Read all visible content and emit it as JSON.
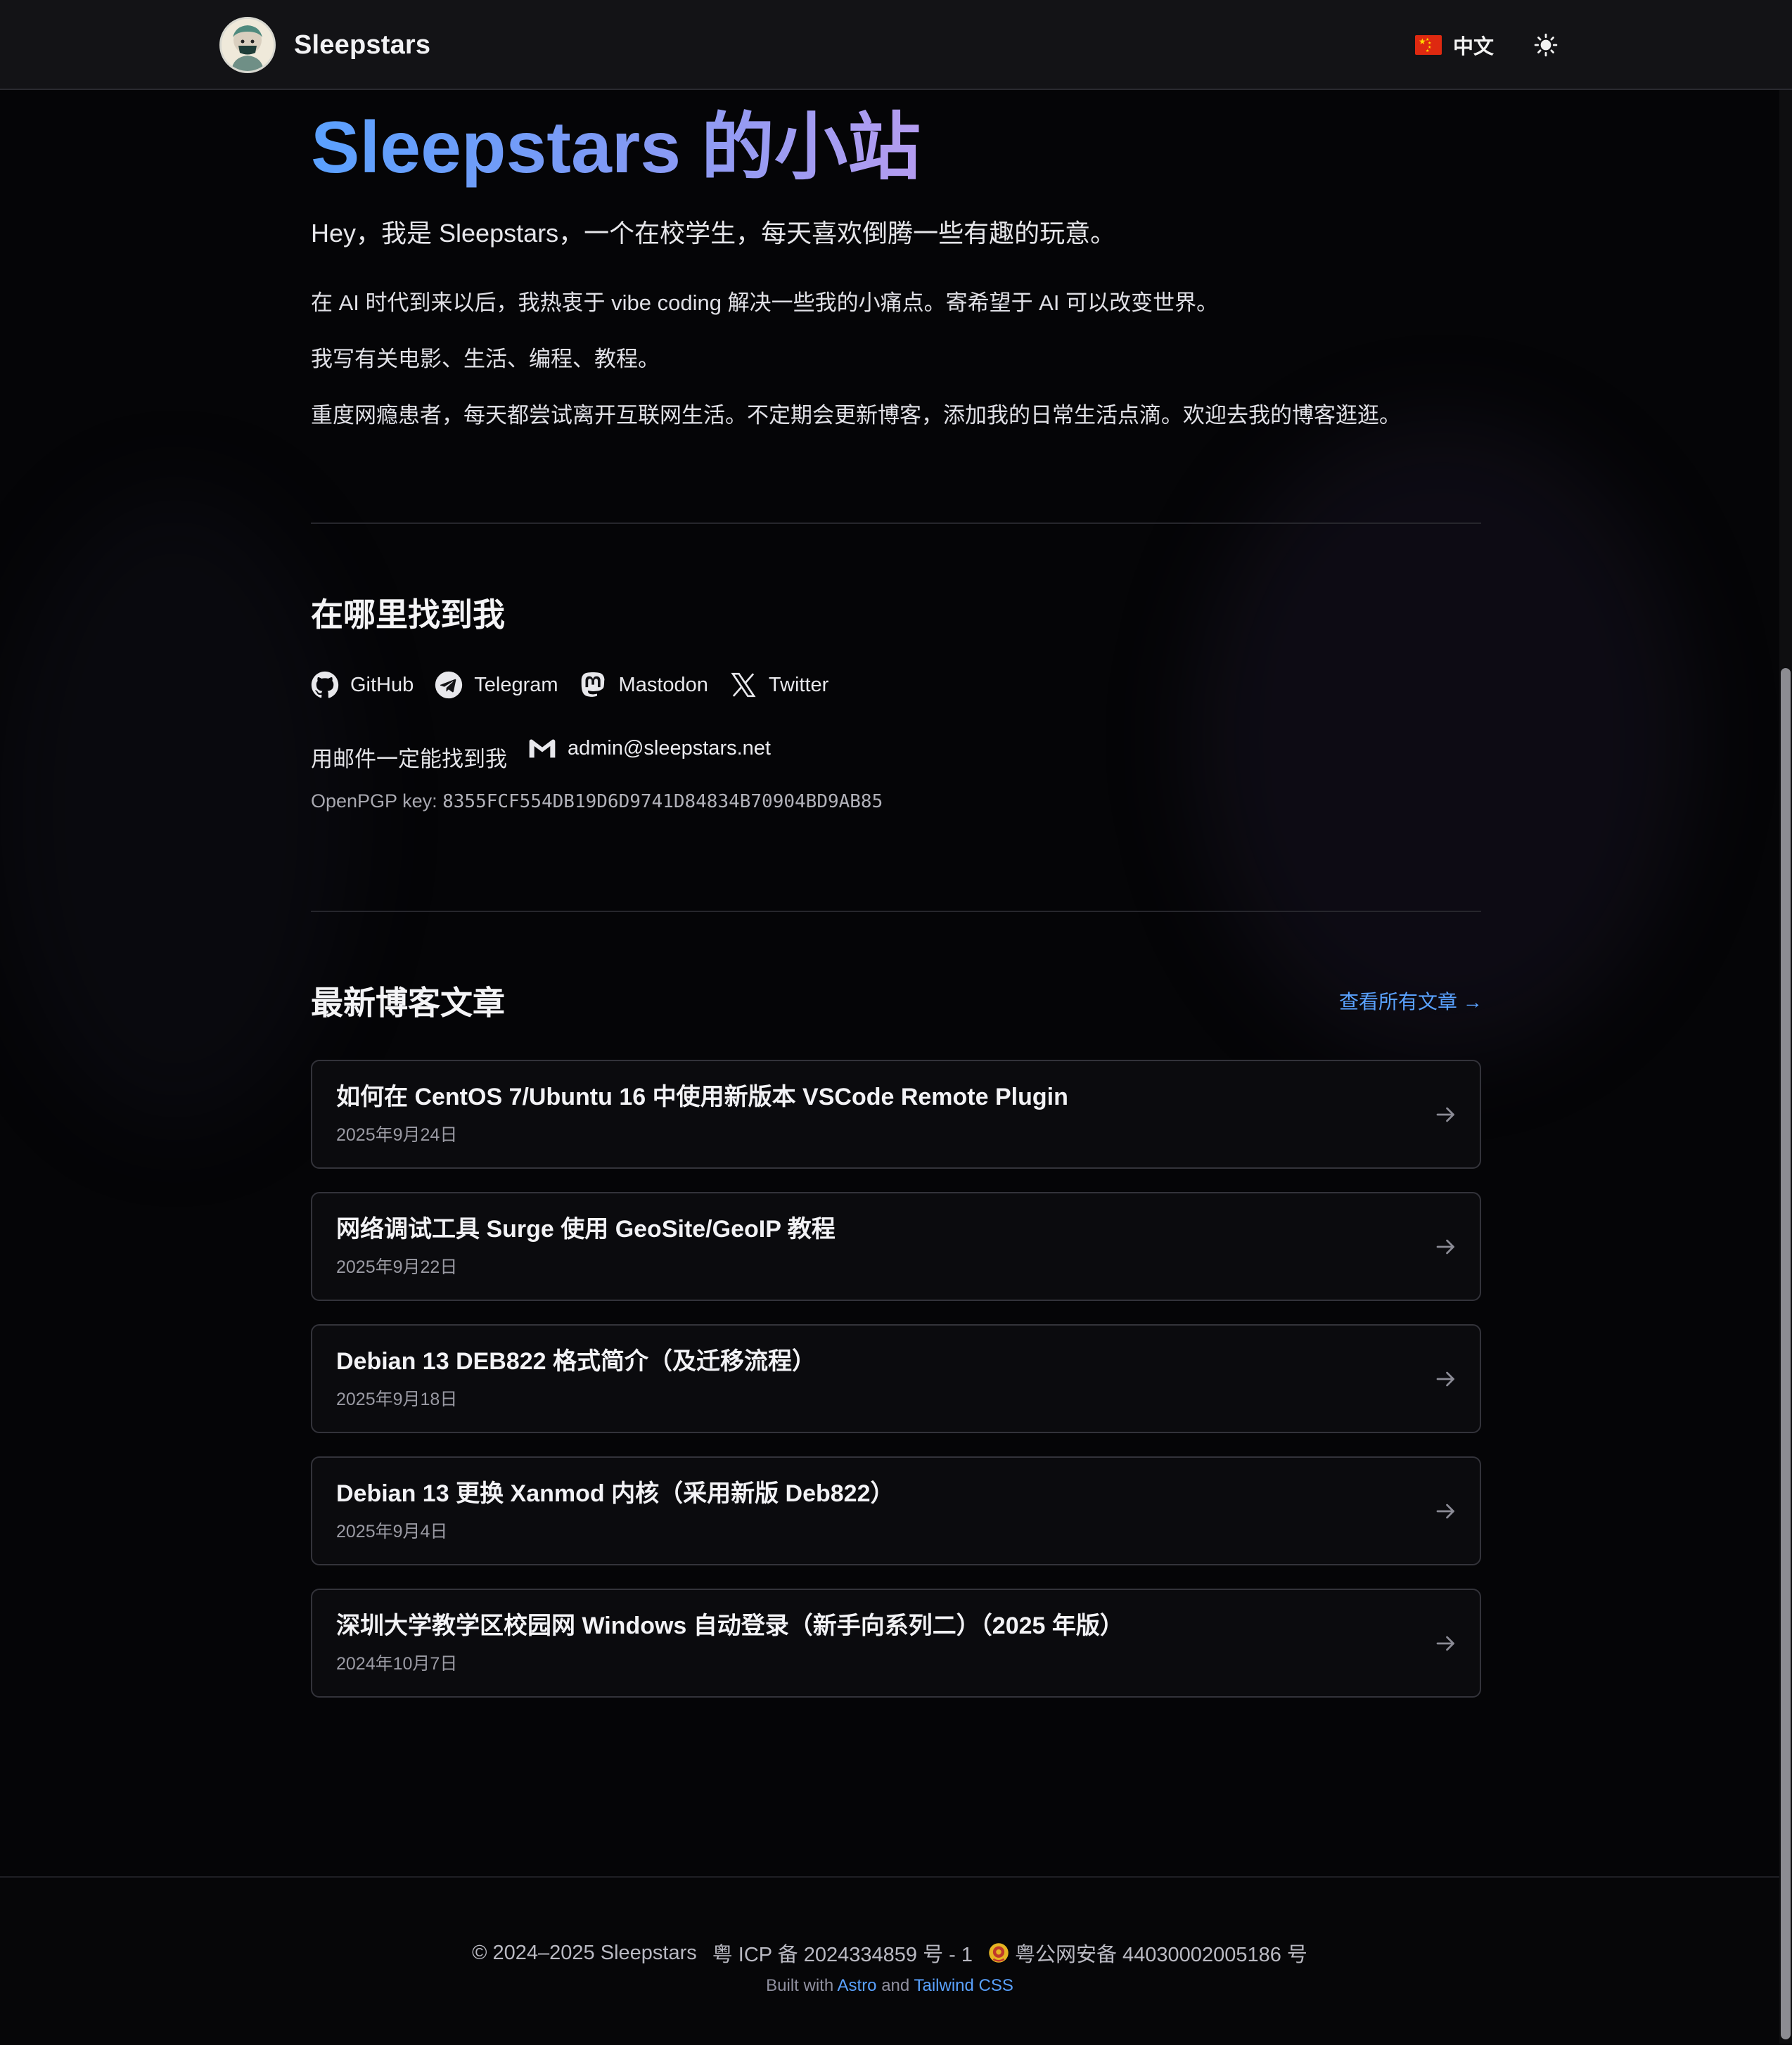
{
  "header": {
    "site_name": "Sleepstars",
    "language_label": "中文"
  },
  "hero": {
    "title": "Sleepstars 的小站",
    "lead": "Hey，我是 Sleepstars，一个在校学生，每天喜欢倒腾一些有趣的玩意。",
    "paragraphs": [
      "在 AI 时代到来以后，我热衷于 vibe coding 解决一些我的小痛点。寄希望于 AI 可以改变世界。",
      "我写有关电影、生活、编程、教程。",
      "重度网瘾患者，每天都尝试离开互联网生活。不定期会更新博客，添加我的日常生活点滴。欢迎去我的博客逛逛。"
    ]
  },
  "find_me": {
    "heading": "在哪里找到我",
    "socials": [
      {
        "label": "GitHub",
        "icon": "github-icon"
      },
      {
        "label": "Telegram",
        "icon": "telegram-icon"
      },
      {
        "label": "Mastodon",
        "icon": "mastodon-icon"
      },
      {
        "label": "Twitter",
        "icon": "x-twitter-icon"
      }
    ],
    "email_text": "用邮件一定能找到我",
    "email": "admin@sleepstars.net",
    "pgp_label": "OpenPGP key: ",
    "pgp_key": "8355FCF554DB19D6D9741D84834B70904BD9AB85"
  },
  "blog": {
    "heading": "最新博客文章",
    "view_all": "查看所有文章 →",
    "posts": [
      {
        "title": "如何在 CentOS 7/Ubuntu 16 中使用新版本 VSCode Remote Plugin",
        "date": "2025年9月24日"
      },
      {
        "title": "网络调试工具 Surge 使用 GeoSite/GeoIP 教程",
        "date": "2025年9月22日"
      },
      {
        "title": "Debian 13 DEB822 格式简介（及迁移流程）",
        "date": "2025年9月18日"
      },
      {
        "title": "Debian 13 更换 Xanmod 内核（采用新版 Deb822）",
        "date": "2025年9月4日"
      },
      {
        "title": "深圳大学教学区校园网 Windows 自动登录（新手向系列二）（2025 年版）",
        "date": "2024年10月7日"
      }
    ]
  },
  "footer": {
    "copyright": "© 2024–2025 Sleepstars",
    "icp": "粤 ICP 备 2024334859 号 - 1",
    "police": "粤公网安备 44030002005186 号",
    "built_with": "Built with",
    "astro": "Astro",
    "and": "and",
    "tailwind": "Tailwind CSS"
  },
  "colors": {
    "accent": "#5aa2ff",
    "background": "#050507",
    "header_bg": "#131316"
  }
}
